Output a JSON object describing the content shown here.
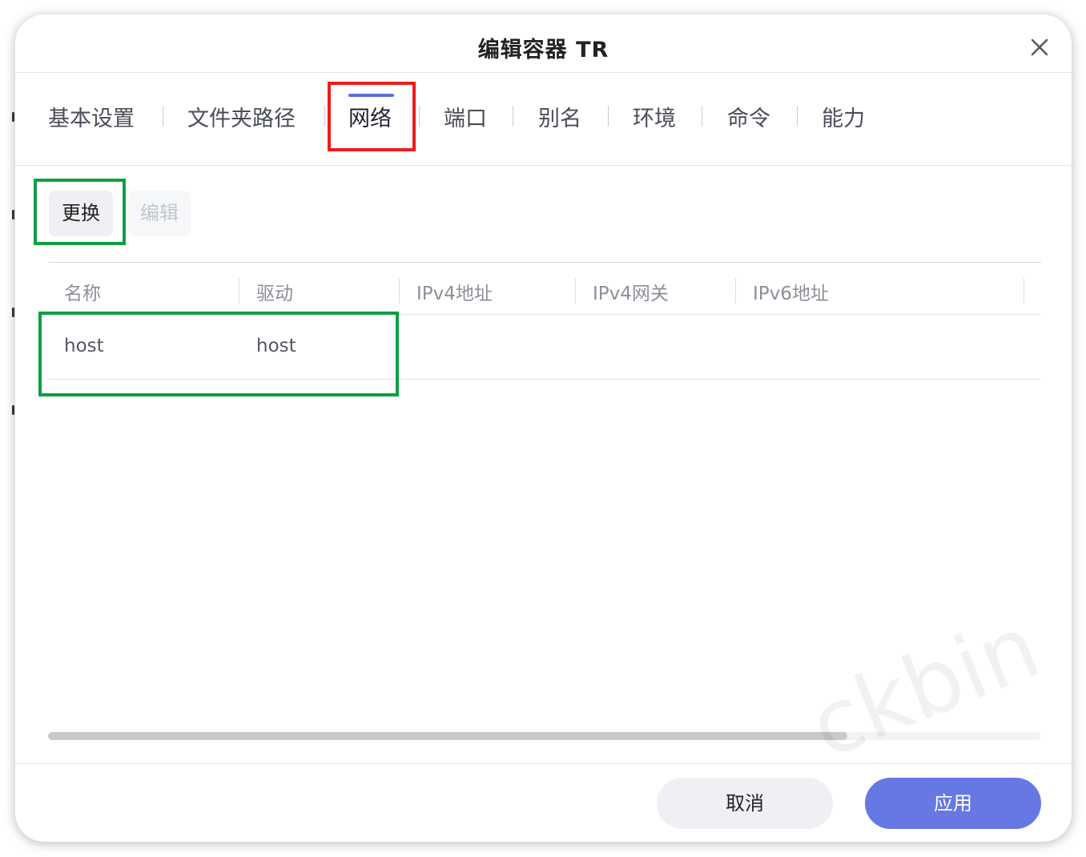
{
  "dialog": {
    "title": "编辑容器 TR"
  },
  "tabs": [
    {
      "label": "基本设置",
      "active": false
    },
    {
      "label": "文件夹路径",
      "active": false
    },
    {
      "label": "网络",
      "active": true
    },
    {
      "label": "端口",
      "active": false
    },
    {
      "label": "别名",
      "active": false
    },
    {
      "label": "环境",
      "active": false
    },
    {
      "label": "命令",
      "active": false
    },
    {
      "label": "能力",
      "active": false
    }
  ],
  "toolbar": {
    "replace_label": "更换",
    "edit_label": "编辑"
  },
  "network_table": {
    "columns": [
      "名称",
      "驱动",
      "IPv4地址",
      "IPv4网关",
      "IPv6地址"
    ],
    "rows": [
      {
        "name": "host",
        "driver": "host",
        "ipv4": "",
        "gateway": "",
        "ipv6": ""
      }
    ]
  },
  "footer": {
    "cancel_label": "取消",
    "apply_label": "应用"
  },
  "watermark": "ckbin",
  "colors": {
    "accent": "#6578e3",
    "tab_underline": "#5a6ee0",
    "highlight_red": "#ee1b1b",
    "highlight_green": "#0f9e43"
  },
  "icons": {
    "close": "close-icon"
  }
}
